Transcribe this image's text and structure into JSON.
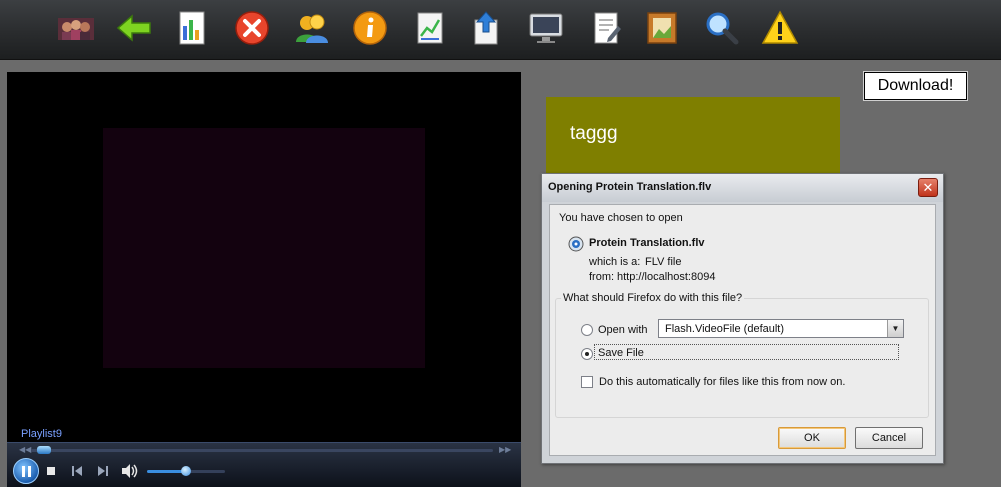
{
  "toolbar": {
    "icons": [
      "people-photo-icon",
      "back-arrow-icon",
      "bar-chart-icon",
      "delete-icon",
      "user-profile-icon",
      "info-icon",
      "chart-document-icon",
      "upload-icon",
      "monitor-icon",
      "document-edit-icon",
      "picture-frame-icon",
      "search-icon",
      "warning-icon"
    ]
  },
  "player": {
    "playlist_label": "Playlist9",
    "seek_position": 0.03,
    "volume_level": 0.55
  },
  "download_button": "Download!",
  "tag": {
    "text": "taggg",
    "color": "#7f7f00"
  },
  "dialog": {
    "title": "Opening Protein Translation.flv",
    "intro": "You have chosen to open",
    "filename": "Protein Translation.flv",
    "which_is_label": "which is a:",
    "which_is_value": "FLV file",
    "from_label": "from:",
    "from_value": "http://localhost:8094",
    "question": "What should Firefox do with this file?",
    "open_with_label": "Open with",
    "open_with_value": "Flash.VideoFile (default)",
    "save_file_label": "Save File",
    "selected_option": "save_file",
    "auto_label": "Do this automatically for files like this from now on.",
    "auto_checked": false,
    "ok_label": "OK",
    "cancel_label": "Cancel"
  }
}
